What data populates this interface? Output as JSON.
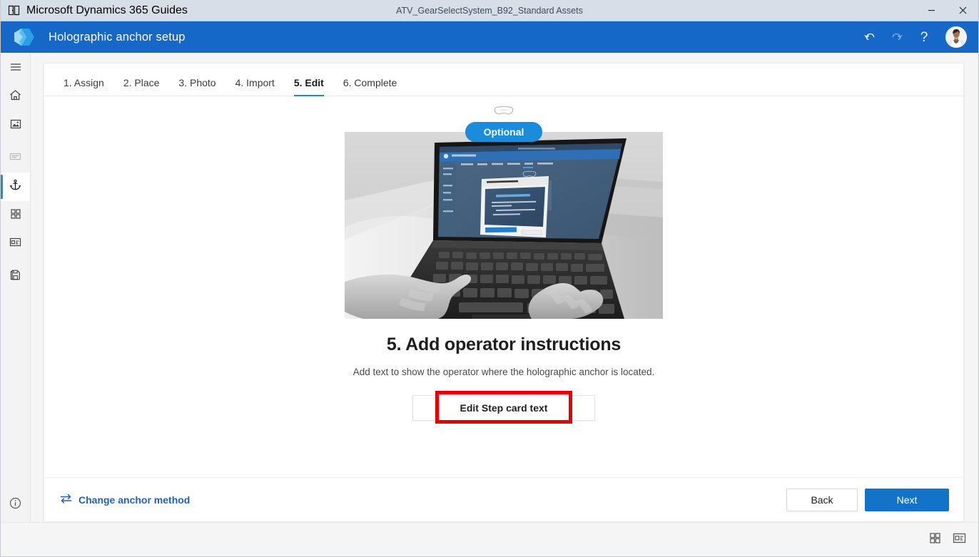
{
  "window": {
    "app_name": "Microsoft Dynamics 365 Guides",
    "document_title": "ATV_GearSelectSystem_B92_Standard Assets",
    "app_icon": "dynamics-guides-icon",
    "controls": [
      {
        "name": "minimize-button",
        "glyph": "minimize-icon"
      },
      {
        "name": "close-button",
        "glyph": "close-icon"
      }
    ]
  },
  "header": {
    "logo": "dynamics-365-guides-logo",
    "title": "Holographic anchor setup",
    "accent_color": "#1668c8",
    "actions": [
      {
        "name": "undo-button",
        "icon": "undo-icon",
        "enabled": true
      },
      {
        "name": "redo-button",
        "icon": "redo-icon",
        "enabled": false
      },
      {
        "name": "help-button",
        "icon": "question-mark-icon",
        "label": "?"
      }
    ],
    "avatar": "user-avatar"
  },
  "sidebar": {
    "items": [
      {
        "name": "menu-toggle",
        "icon": "hamburger-icon",
        "state": "normal"
      },
      {
        "name": "home",
        "icon": "home-icon",
        "state": "normal"
      },
      {
        "name": "media",
        "icon": "image-icon",
        "state": "normal"
      },
      {
        "name": "step-card",
        "icon": "text-card-icon",
        "state": "disabled"
      },
      {
        "name": "anchor",
        "icon": "anchor-icon",
        "state": "active"
      },
      {
        "name": "apps",
        "icon": "grid-icon",
        "state": "normal"
      },
      {
        "name": "layout",
        "icon": "card-layout-icon",
        "state": "normal"
      },
      {
        "name": "save",
        "icon": "save-icon",
        "state": "normal"
      }
    ],
    "bottom": {
      "name": "info",
      "icon": "info-circle-icon"
    }
  },
  "tabs": [
    {
      "label": "1. Assign",
      "active": false
    },
    {
      "label": "2. Place",
      "active": false
    },
    {
      "label": "3. Photo",
      "active": false
    },
    {
      "label": "4. Import",
      "active": false
    },
    {
      "label": "5. Edit",
      "active": true
    },
    {
      "label": "6. Complete",
      "active": false
    }
  ],
  "stage": {
    "headset_icon": "hololens-headset-icon",
    "badge": "Optional",
    "badge_color": "#1a8cdb",
    "illustration": "photo-hands-typing-on-laptop-with-guides-dialog",
    "illustration_caption": "Grayscale photo: hands typing on a laptop showing the Edit anchoring instructions dialog with Align Digital Anchor text",
    "title": "5. Add operator instructions",
    "description": "Add text to show the operator where the holographic anchor is located.",
    "primary_action": "Edit Step card text",
    "highlight_color": "#e60000"
  },
  "card_footer": {
    "change_link": "Change anchor method",
    "change_icon": "swap-arrows-icon",
    "back_label": "Back",
    "next_label": "Next"
  },
  "statusbar": {
    "views": [
      {
        "name": "grid-view-toggle",
        "icon": "grid-view-icon"
      },
      {
        "name": "detail-view-toggle",
        "icon": "detail-view-icon"
      }
    ]
  }
}
